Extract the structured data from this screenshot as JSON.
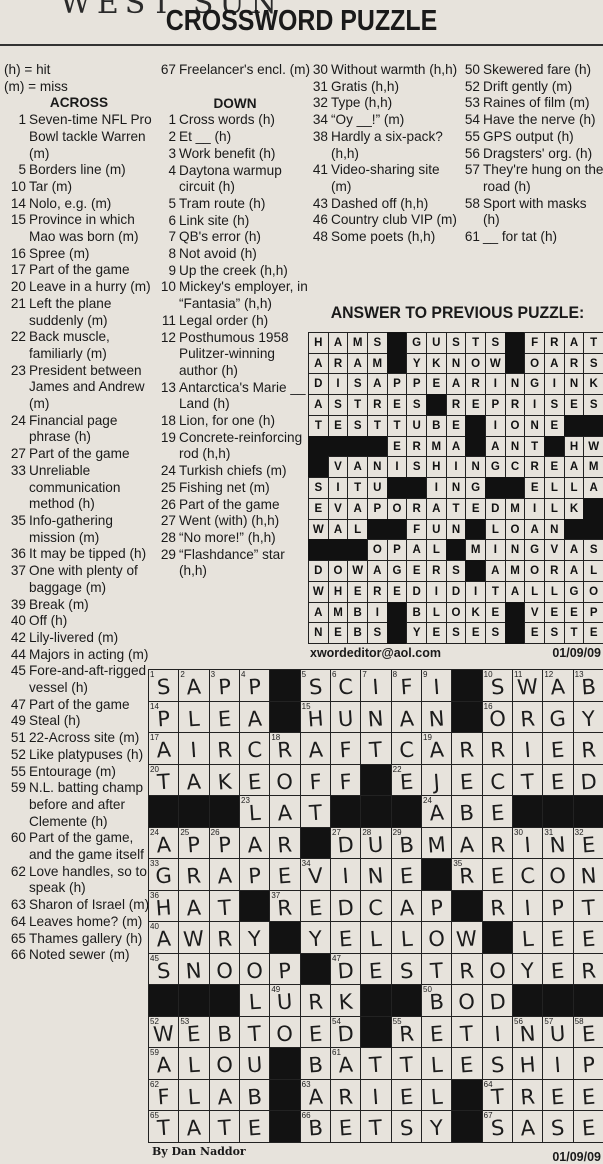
{
  "header": {
    "scrawl": "WEST SUN",
    "title": "CROSSWORD PUZZLE"
  },
  "legend": [
    "(h) = hit",
    "(m) = miss"
  ],
  "across_heading": "ACROSS",
  "down_heading": "DOWN",
  "col1": [
    {
      "n": "1",
      "t": "Seven-time NFL Pro Bowl tackle Warren (m)"
    },
    {
      "n": "5",
      "t": "Borders line (m)"
    },
    {
      "n": "10",
      "t": "Tar (m)"
    },
    {
      "n": "14",
      "t": "Nolo, e.g. (m)"
    },
    {
      "n": "15",
      "t": "Province in which Mao was born (m)"
    },
    {
      "n": "16",
      "t": "Spree (m)"
    },
    {
      "n": "17",
      "t": "Part of the game"
    },
    {
      "n": "20",
      "t": "Leave in a hurry (m)"
    },
    {
      "n": "21",
      "t": "Left the plane suddenly (m)"
    },
    {
      "n": "22",
      "t": "Back muscle, familiarly (m)"
    },
    {
      "n": "23",
      "t": "President between James and Andrew (m)"
    },
    {
      "n": "24",
      "t": "Financial page phrase (h)"
    },
    {
      "n": "27",
      "t": "Part of the game"
    },
    {
      "n": "33",
      "t": "Unreliable communication method (h)"
    },
    {
      "n": "35",
      "t": "Info-gathering mission (m)"
    },
    {
      "n": "36",
      "t": "It may be tipped (h)"
    },
    {
      "n": "37",
      "t": "One with plenty of baggage (m)"
    },
    {
      "n": "39",
      "t": "Break (m)"
    },
    {
      "n": "40",
      "t": "Off (h)"
    },
    {
      "n": "42",
      "t": "Lily-livered (m)"
    },
    {
      "n": "44",
      "t": "Majors in acting (m)"
    },
    {
      "n": "45",
      "t": "Fore-and-aft-rigged vessel (h)"
    },
    {
      "n": "47",
      "t": "Part of the game"
    },
    {
      "n": "49",
      "t": "Steal (h)"
    },
    {
      "n": "51",
      "t": "22-Across site (m)"
    },
    {
      "n": "52",
      "t": "Like platypuses (h)"
    },
    {
      "n": "55",
      "t": "Entourage (m)"
    },
    {
      "n": "59",
      "t": "N.L. batting champ before and after Clemente (h)"
    },
    {
      "n": "60",
      "t": "Part of the game, and the game itself"
    },
    {
      "n": "62",
      "t": "Love handles, so to speak (h)"
    },
    {
      "n": "63",
      "t": "Sharon of Israel (m)"
    },
    {
      "n": "64",
      "t": "Leaves home? (m)"
    },
    {
      "n": "65",
      "t": "Thames gallery (h)"
    },
    {
      "n": "66",
      "t": "Noted sewer (m)"
    }
  ],
  "col2_top": [
    {
      "n": "67",
      "t": "Freelancer's encl. (m)"
    }
  ],
  "col2": [
    {
      "n": "1",
      "t": "Cross words (h)"
    },
    {
      "n": "2",
      "t": "Et __ (h)"
    },
    {
      "n": "3",
      "t": "Work benefit (h)"
    },
    {
      "n": "4",
      "t": "Daytona warmup circuit (h)"
    },
    {
      "n": "5",
      "t": "Tram route (h)"
    },
    {
      "n": "6",
      "t": "Link site (h)"
    },
    {
      "n": "7",
      "t": "QB's error (h)"
    },
    {
      "n": "8",
      "t": "Not avoid (h)"
    },
    {
      "n": "9",
      "t": "Up the creek (h,h)"
    },
    {
      "n": "10",
      "t": "Mickey's employer, in “Fantasia” (h,h)"
    },
    {
      "n": "11",
      "t": "Legal order (h)"
    },
    {
      "n": "12",
      "t": "Posthumous 1958 Pulitzer-winning author (h)"
    },
    {
      "n": "13",
      "t": "Antarctica's Marie __ Land (h)"
    },
    {
      "n": "18",
      "t": "Lion, for one (h)"
    },
    {
      "n": "19",
      "t": "Concrete-reinforcing rod (h,h)"
    },
    {
      "n": "24",
      "t": "Turkish chiefs (m)"
    },
    {
      "n": "25",
      "t": "Fishing net (m)"
    },
    {
      "n": "26",
      "t": "Part of the game"
    },
    {
      "n": "27",
      "t": "Went (with) (h,h)"
    },
    {
      "n": "28",
      "t": "“No more!” (h,h)"
    },
    {
      "n": "29",
      "t": "“Flashdance” star (h,h)"
    }
  ],
  "col3": [
    {
      "n": "30",
      "t": "Without warmth (h,h)"
    },
    {
      "n": "31",
      "t": "Gratis (h,h)"
    },
    {
      "n": "32",
      "t": "Type (h,h)"
    },
    {
      "n": "34",
      "t": "“Oy __!” (m)"
    },
    {
      "n": "38",
      "t": "Hardly a six-pack? (h,h)"
    },
    {
      "n": "41",
      "t": "Video-sharing site (m)"
    },
    {
      "n": "43",
      "t": "Dashed off (h,h)"
    },
    {
      "n": "46",
      "t": "Country club VIP (m)"
    },
    {
      "n": "48",
      "t": "Some poets (h,h)"
    }
  ],
  "col4": [
    {
      "n": "50",
      "t": "Skewered fare (h)"
    },
    {
      "n": "52",
      "t": "Drift gently (m)"
    },
    {
      "n": "53",
      "t": "Raines of film (m)"
    },
    {
      "n": "54",
      "t": "Have the nerve (h)"
    },
    {
      "n": "55",
      "t": "GPS output (h)"
    },
    {
      "n": "56",
      "t": "Dragsters' org. (h)"
    },
    {
      "n": "57",
      "t": "They're hung on the road (h)"
    },
    {
      "n": "58",
      "t": "Sport with masks (h)"
    },
    {
      "n": "61",
      "t": "__ for tat (h)"
    }
  ],
  "answer_title": "ANSWER TO PREVIOUS PUZZLE:",
  "answer_rows": [
    "HAMS.GUSTS.FRAT",
    "ARAM.YKNOW.OARS",
    "DISAPPEARINGINK",
    "ASTRES.REPRISES",
    "TESTTUBE.IONE..",
    "....ERMA.ANT.HWY",
    ".VANISHINGCREAM",
    "SITU..ING..ELLA",
    "EVAPORATEDMILK.",
    "WAL..FUN.LOAN..",
    "...OPAL.MINGVASE",
    "DOWAGERS.AMORAL",
    "WHEREDIDITALLGO",
    "AMBI.BLOKE.VEEP",
    "NEBS.YESES.ESTE"
  ],
  "answer_email": "xwordeditor@aol.com",
  "answer_date": "01/09/09",
  "grid_rows": [
    "SAPP.SCIFI.SWAB",
    "PLEA.HUNAN.ORGY",
    "AIRCRAFTCARRIER",
    "TAKEOFF.EJECTED",
    "...LAT...ABE...",
    "APPAR.DUBMARINE",
    "GRAPEVINE.RECON",
    "HAT.REDCAP.RIPT",
    "AWRY.YELLOW.LEE",
    "SNOOP.DESTROYER",
    "...LURK..BOD...",
    "WEBTOED.RETINUE",
    "ALOU.BATTLESHIP",
    "FLAB.ARIEL.TREE",
    "TATE.BETSY.SASE"
  ],
  "grid_numbers": {
    "0,0": "1",
    "0,1": "2",
    "0,2": "3",
    "0,3": "4",
    "0,5": "5",
    "0,6": "6",
    "0,7": "7",
    "0,8": "8",
    "0,9": "9",
    "0,11": "10",
    "0,12": "11",
    "0,13": "12",
    "0,14": "13",
    "1,0": "14",
    "1,5": "15",
    "1,11": "16",
    "2,0": "17",
    "2,4": "18",
    "2,9": "19",
    "3,0": "20",
    "3,8": "22",
    "4,3": "23",
    "4,9": "24",
    "5,0": "24",
    "5,1": "25",
    "5,2": "26",
    "5,6": "27",
    "5,7": "28",
    "5,8": "29",
    "5,12": "30",
    "5,13": "31",
    "5,14": "32",
    "6,0": "33",
    "6,5": "34",
    "6,10": "35",
    "7,0": "36",
    "7,4": "37",
    "7,10": "38",
    "8,0": "40",
    "8,11": "44",
    "9,0": "45",
    "9,6": "47",
    "10,4": "49",
    "10,9": "50",
    "11,0": "52",
    "11,1": "53",
    "11,6": "54",
    "11,8": "55",
    "11,12": "56",
    "11,13": "57",
    "11,14": "58",
    "12,0": "59",
    "12,6": "61",
    "13,0": "62",
    "13,5": "63",
    "13,11": "64",
    "14,0": "65",
    "14,5": "66",
    "14,11": "67"
  },
  "byline": "By Dan Naddor",
  "bottom_date": "01/09/09"
}
